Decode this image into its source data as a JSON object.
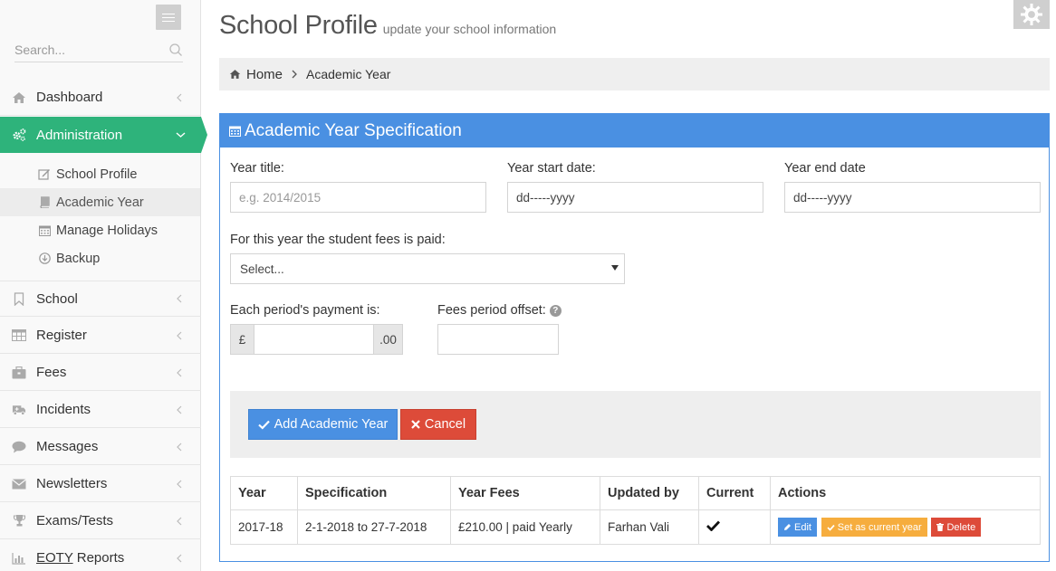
{
  "sidebar": {
    "search_placeholder": "Search...",
    "items": [
      {
        "label": "Dashboard",
        "icon": "home-icon"
      },
      {
        "label": "Administration",
        "icon": "cogs-icon",
        "active": true
      },
      {
        "label": "School",
        "icon": "bookmark-icon"
      },
      {
        "label": "Register",
        "icon": "table-icon"
      },
      {
        "label": "Fees",
        "icon": "briefcase-icon"
      },
      {
        "label": "Incidents",
        "icon": "ambulance-icon"
      },
      {
        "label": "Messages",
        "icon": "comment-icon"
      },
      {
        "label": "Newsletters",
        "icon": "envelope-icon"
      },
      {
        "label": "Exams/Tests",
        "icon": "trophy-icon"
      },
      {
        "label_abbr": "EOTY",
        "label_rest": " Reports",
        "icon": "bar-chart-icon"
      }
    ],
    "subitems": [
      {
        "label": "School Profile",
        "icon": "edit-icon"
      },
      {
        "label": "Academic Year",
        "icon": "book-icon",
        "current": true
      },
      {
        "label": "Manage Holidays",
        "icon": "calendar-icon"
      },
      {
        "label": "Backup",
        "icon": "download-icon"
      }
    ]
  },
  "header": {
    "title": "School Profile",
    "subtitle": "update your school information"
  },
  "breadcrumb": {
    "home": "Home",
    "current": "Academic Year"
  },
  "panel": {
    "title": "Academic Year Specification",
    "fields": {
      "year_title_label": "Year title:",
      "year_title_placeholder": "e.g. 2014/2015",
      "start_label": "Year start date:",
      "start_value": "dd-----yyyy",
      "end_label": "Year end date",
      "end_value": "dd-----yyyy",
      "fees_paid_label": "For this year the student fees is paid:",
      "fees_paid_selected": "Select...",
      "payment_label": "Each period's payment is:",
      "currency": "£",
      "decimals": ".00",
      "offset_label": "Fees period offset:",
      "help_glyph": "?"
    },
    "buttons": {
      "add": "Add Academic Year",
      "cancel": "Cancel"
    },
    "table": {
      "headers": [
        "Year",
        "Specification",
        "Year Fees",
        "Updated by",
        "Current",
        "Actions"
      ],
      "rows": [
        {
          "year": "2017-18",
          "specification": "2-1-2018 to 27-7-2018",
          "fees": "£210.00 | paid Yearly",
          "updated_by": "Farhan Vali",
          "current": true,
          "actions": {
            "edit": "Edit",
            "set_current": "Set as current year",
            "delete": "Delete"
          }
        }
      ]
    }
  },
  "colors": {
    "accent_green": "#2eb37b",
    "primary_blue": "#4a90e2",
    "danger_red": "#dd4b39",
    "warning_orange": "#f6ad3e"
  }
}
